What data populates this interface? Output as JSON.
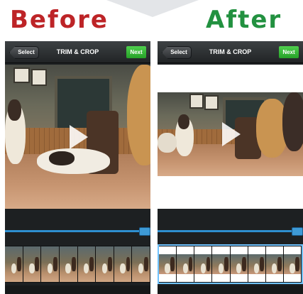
{
  "headings": {
    "before": "Before",
    "after": "After"
  },
  "before_phone": {
    "toolbar": {
      "select_label": "Select",
      "title": "TRIM & CROP",
      "next_label": "Next"
    }
  },
  "after_phone": {
    "toolbar": {
      "select_label": "Select",
      "title": "TRIM & CROP",
      "next_label": "Next"
    }
  },
  "colors": {
    "before_heading": "#bd2427",
    "after_heading": "#229140",
    "next_button": "#36b536",
    "timeline_accent": "#2e8fd0"
  },
  "icons": [
    "play-icon",
    "back-chevron-icon"
  ]
}
